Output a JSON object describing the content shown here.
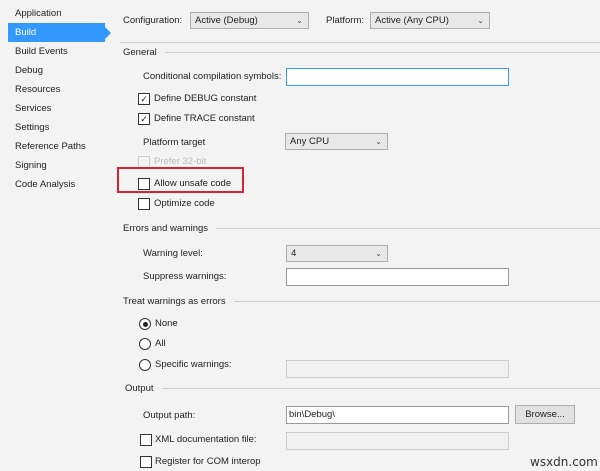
{
  "sidebar": {
    "items": [
      "Application",
      "Build",
      "Build Events",
      "Debug",
      "Resources",
      "Services",
      "Settings",
      "Reference Paths",
      "Signing",
      "Code Analysis"
    ],
    "selected": "Build"
  },
  "toolbar": {
    "configuration_label": "Configuration:",
    "configuration_value": "Active (Debug)",
    "platform_label": "Platform:",
    "platform_value": "Active (Any CPU)"
  },
  "general": {
    "title": "General",
    "conditional_label": "Conditional compilation symbols:",
    "conditional_value": "",
    "define_debug": "Define DEBUG constant",
    "define_trace": "Define TRACE constant",
    "platform_target_label": "Platform target",
    "platform_target_value": "Any CPU",
    "prefer32": "Prefer 32-bit",
    "allow_unsafe": "Allow unsafe code",
    "optimize": "Optimize code"
  },
  "errors": {
    "title": "Errors and warnings",
    "warning_level_label": "Warning level:",
    "warning_level_value": "4",
    "suppress_label": "Suppress warnings:",
    "suppress_value": ""
  },
  "treat": {
    "title": "Treat warnings as errors",
    "none": "None",
    "all": "All",
    "specific": "Specific warnings:"
  },
  "output": {
    "title": "Output",
    "path_label": "Output path:",
    "path_value": "bin\\Debug\\",
    "browse": "Browse...",
    "xml_label": "XML documentation file:",
    "com_label": "Register for COM interop"
  },
  "watermark": "wsxdn.com",
  "colors": {
    "accent": "#3399ff",
    "highlight": "#d9232d"
  }
}
